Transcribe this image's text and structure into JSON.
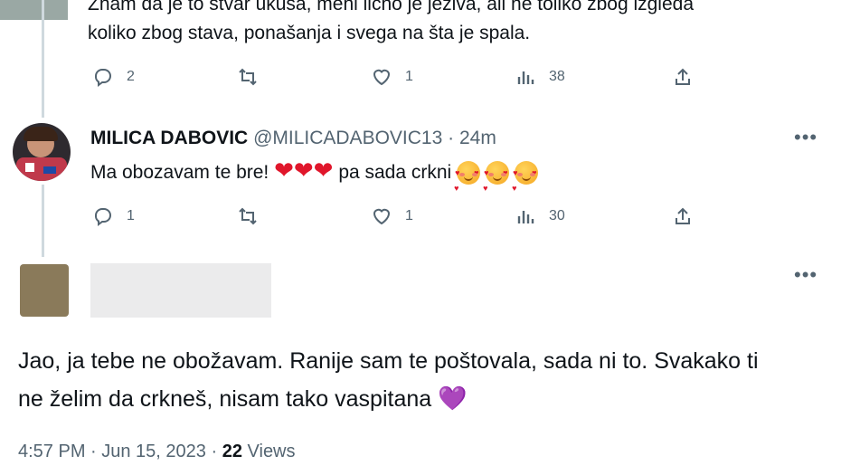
{
  "tweet1": {
    "line1": "Znam da je to stvar ukusa, meni lično je jeziva, ali ne toliko zbog izgleda",
    "line2": "koliko zbog stava, ponašanja i svega na šta je spala.",
    "replies": "2",
    "likes": "1",
    "views": "38"
  },
  "tweet2": {
    "name": "MILICA DABOVIC",
    "handle": "@MILICADABOVIC13",
    "dot": "·",
    "time": "24m",
    "text_start": "Ma obozavam te bre!",
    "text_end": "pa sada crkni",
    "hearts": "❤❤❤",
    "replies": "1",
    "likes": "1",
    "views": "30"
  },
  "tweet3": {
    "line1": "Jao, ja tebe ne obožavam. Ranije sam te poštovala, sada ni to. Svakako ti",
    "line2": "ne želim da crkneš, nisam tako vaspitana",
    "purple_heart": "💜",
    "timestamp": "4:57 PM · Jun 15, 2023 ·",
    "views_count": "22",
    "views_label": "Views"
  },
  "more_glyph": "•••",
  "colors": {
    "text": "#0f1419",
    "muted": "#536471",
    "thread_line": "#cfd9de",
    "heart": "#e0162b",
    "purple": "#a67ce0"
  },
  "icons": [
    "reply-icon",
    "retweet-icon",
    "like-icon",
    "views-icon",
    "share-icon",
    "more-icon"
  ]
}
